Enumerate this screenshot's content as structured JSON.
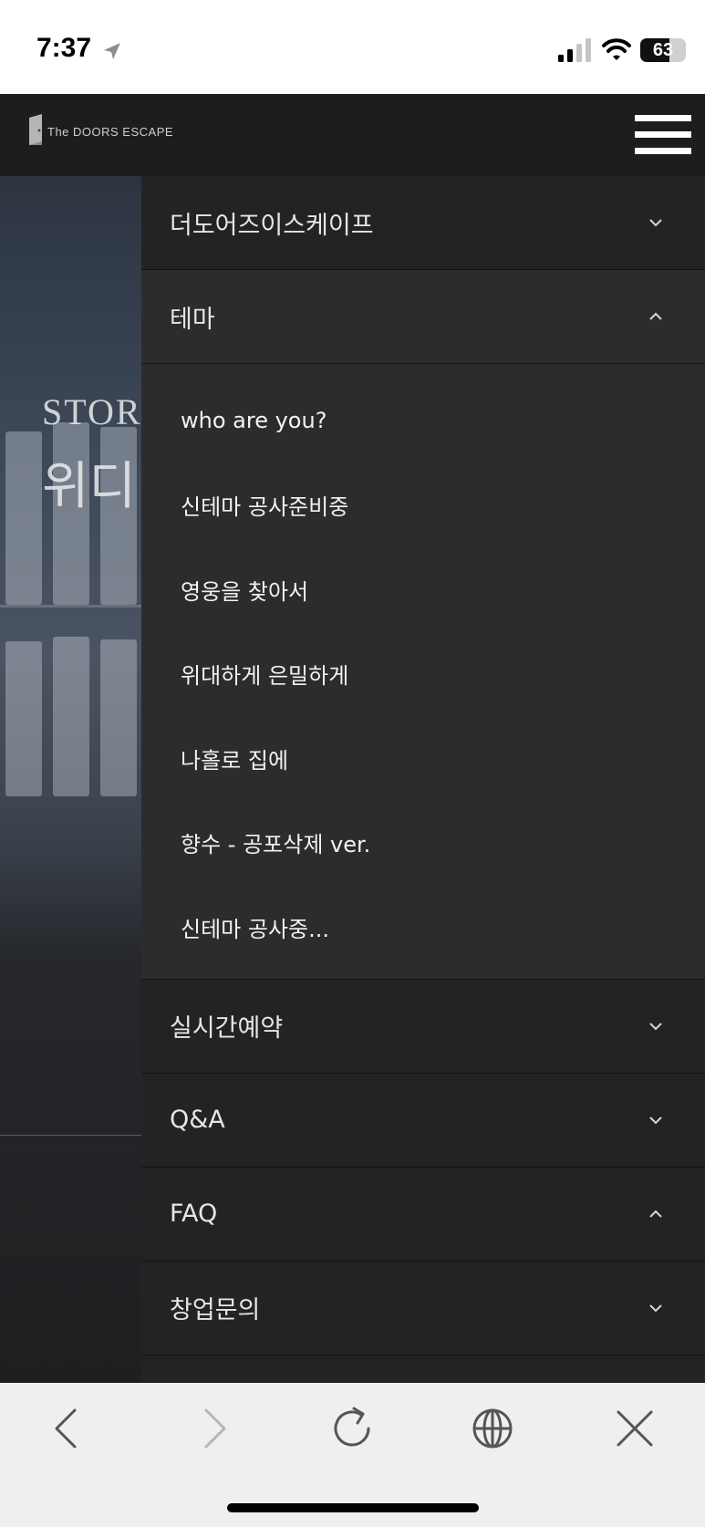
{
  "status_bar": {
    "time": "7:37",
    "battery": "63",
    "battery_level": 0.63,
    "icons": [
      "location-arrow-icon",
      "signal-icon",
      "wifi-icon",
      "battery-icon"
    ]
  },
  "header": {
    "logo_text": "The DOORS ESCAPE",
    "menu_icon": "hamburger-icon"
  },
  "background": {
    "heading_small": "STOR",
    "heading_large": "위디"
  },
  "menu": {
    "items": [
      {
        "label": "더도어즈이스케이프",
        "chevron": "down"
      },
      {
        "label": "테마",
        "chevron": "up"
      },
      {
        "label": "실시간예약",
        "chevron": "down"
      },
      {
        "label": "Q&A",
        "chevron": "down"
      },
      {
        "label": "FAQ",
        "chevron": "up"
      },
      {
        "label": "창업문의",
        "chevron": "down"
      }
    ],
    "theme_submenu": [
      "who are you?",
      "신테마 공사준비중",
      "영웅을 찾아서",
      "위대하게 은밀하게",
      "나홀로 집에",
      "향수 - 공포삭제 ver.",
      "신테마 공사중..."
    ]
  },
  "toolbar": {
    "icons": [
      "back-icon",
      "forward-icon",
      "reload-icon",
      "globe-icon",
      "close-icon"
    ]
  },
  "colors": {
    "header_bg": "#1d1d1f",
    "drawer_bg": "#232325",
    "submenu_bg": "#2d2b2c",
    "divider": "#0f1612",
    "toolbar_bg": "#efefef"
  }
}
